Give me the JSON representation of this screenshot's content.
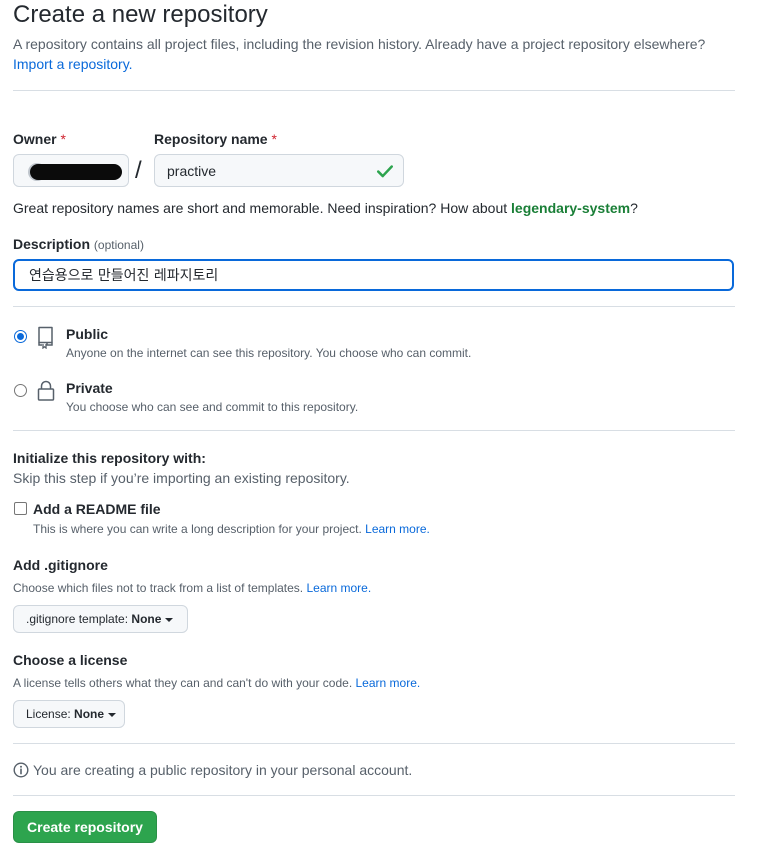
{
  "header": {
    "title": "Create a new repository",
    "subtitle": "A repository contains all project files, including the revision history. Already have a project repository elsewhere?",
    "import_link": "Import a repository."
  },
  "owner": {
    "label": "Owner",
    "required_mark": "*",
    "value_redacted": true
  },
  "separator": "/",
  "repository_name": {
    "label": "Repository name",
    "required_mark": "*",
    "value": "practive",
    "valid": true
  },
  "inspiration": {
    "text": "Great repository names are short and memorable. Need inspiration? How about ",
    "suggestion": "legendary-system",
    "suffix": "?"
  },
  "description": {
    "label": "Description",
    "optional": "(optional)",
    "value": "연습용으로 만들어진 레파지토리"
  },
  "visibility": {
    "selected": "public",
    "public": {
      "title": "Public",
      "desc": "Anyone on the internet can see this repository. You choose who can commit."
    },
    "private": {
      "title": "Private",
      "desc": "You choose who can see and commit to this repository."
    }
  },
  "initialize": {
    "title": "Initialize this repository with:",
    "desc": "Skip this step if you’re importing an existing repository.",
    "readme": {
      "label": "Add a README file",
      "checked": false,
      "desc": "This is where you can write a long description for your project. ",
      "learn_more": "Learn more."
    }
  },
  "gitignore": {
    "title": "Add .gitignore",
    "desc": "Choose which files not to track from a list of templates. ",
    "learn_more": "Learn more.",
    "button_prefix": ".gitignore template: ",
    "button_value": "None"
  },
  "license": {
    "title": "Choose a license",
    "desc": "A license tells others what they can and can't do with your code. ",
    "learn_more": "Learn more.",
    "button_prefix": "License: ",
    "button_value": "None"
  },
  "notice": {
    "text": "You are creating a public repository in your personal account."
  },
  "submit": {
    "label": "Create repository"
  },
  "colors": {
    "primary_button": "#2da44e",
    "link": "#0969da",
    "success": "#1a7f37",
    "required": "#cf222e",
    "focus_border": "#0969da"
  },
  "icons": {
    "public": "repo-icon",
    "private": "lock-icon",
    "valid": "check-icon",
    "info": "info-icon"
  }
}
